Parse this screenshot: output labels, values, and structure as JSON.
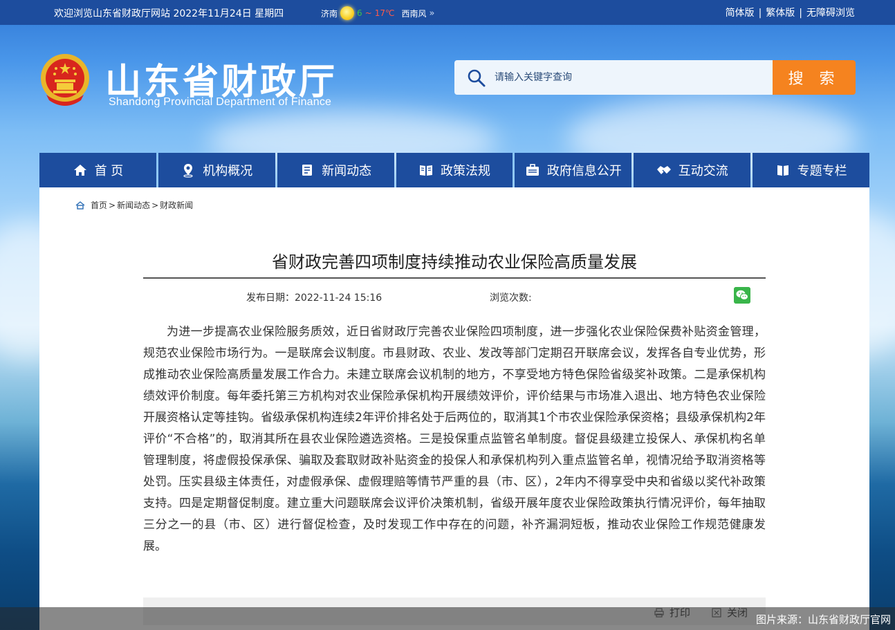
{
  "topbar": {
    "welcome": "欢迎浏览山东省财政厅网站  2022年11月24日 星期四",
    "weather_city": "济南",
    "weather_icon": "sun-icon",
    "temp_low": "6",
    "temp_tilde": "~",
    "temp_high": "17℃",
    "wind": "西南风",
    "links": [
      "简体版",
      "繁体版",
      "无障碍浏览"
    ],
    "separator": "|"
  },
  "header": {
    "title": "山东省财政厅",
    "subtitle": "Shandong Provincial Department of Finance"
  },
  "search": {
    "placeholder": "请输入关键字查询",
    "button_label": "搜 索"
  },
  "nav": {
    "items": [
      {
        "label": "首 页",
        "icon": "home-icon"
      },
      {
        "label": "机构概况",
        "icon": "location-pin-icon"
      },
      {
        "label": "新闻动态",
        "icon": "news-icon"
      },
      {
        "label": "政策法规",
        "icon": "book-icon"
      },
      {
        "label": "政府信息公开",
        "icon": "briefcase-icon"
      },
      {
        "label": "互动交流",
        "icon": "handshake-icon"
      },
      {
        "label": "专题专栏",
        "icon": "open-book-icon"
      }
    ]
  },
  "breadcrumb": {
    "items": [
      "首页",
      "新闻动态",
      "财政新闻"
    ],
    "sep": ">"
  },
  "article": {
    "title": "省财政完善四项制度持续推动农业保险高质量发展",
    "date_label": "发布日期：2022-11-24 15:16",
    "views_label": "浏览次数:",
    "share_icon": "wechat-icon",
    "body": "为进一步提高农业保险服务质效，近日省财政厅完善农业保险四项制度，进一步强化农业保险保费补贴资金管理，规范农业保险市场行为。一是联席会议制度。市县财政、农业、发改等部门定期召开联席会议，发挥各自专业优势，形成推动农业保险高质量发展工作合力。未建立联席会议机制的地方，不享受地方特色保险省级奖补政策。二是承保机构绩效评价制度。每年委托第三方机构对农业保险承保机构开展绩效评价，评价结果与市场准入退出、地方特色农业保险开展资格认定等挂钩。省级承保机构连续2年评价排名处于后两位的，取消其1个市农业保险承保资格；县级承保机构2年评价“不合格”的，取消其所在县农业保险遴选资格。三是投保重点监管名单制度。督促县级建立投保人、承保机构名单管理制度，将虚假投保承保、骗取及套取财政补贴资金的投保人和承保机构列入重点监管名单，视情况给予取消资格等处罚。压实县级主体责任，对虚假承保、虚假理赔等情节严重的县（市、区），2年内不得享受中央和省级以奖代补政策支持。四是定期督促制度。建立重大问题联席会议评价决策机制，省级开展年度农业保险政策执行情况评价，每年抽取三分之一的县（市、区）进行督促检查，及时发现工作中存在的问题，补齐漏洞短板，推动农业保险工作规范健康发展。"
  },
  "footer": {
    "print_label": "打印",
    "close_label": "关闭",
    "source_caption": "图片来源：山东省财政厅官网"
  },
  "colors": {
    "nav_blue": "#1d4d9e",
    "search_orange": "#f5831f"
  }
}
